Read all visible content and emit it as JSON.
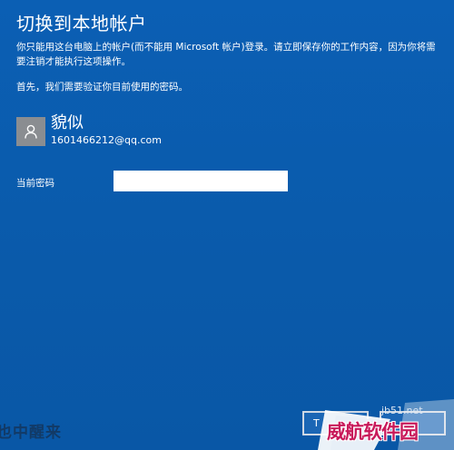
{
  "dialog": {
    "title": "切换到本地帐户",
    "description": "你只能用这台电脑上的帐户(而不能用 Microsoft 帐户)登录。请立即保存你的工作内容，因为你将需要注销才能执行这项操作。",
    "first_step": "首先，我们需要验证你目前使用的密码。"
  },
  "account": {
    "icon": "user-icon",
    "name": "貌似",
    "email": "1601466212@qq.com"
  },
  "password": {
    "label": "当前密码",
    "value": ""
  },
  "buttons": {
    "next_label": "T",
    "cancel_label": ""
  },
  "watermark": {
    "left_text": "也中醒来",
    "site": "jb51.net",
    "brand": "威航软件园"
  }
}
